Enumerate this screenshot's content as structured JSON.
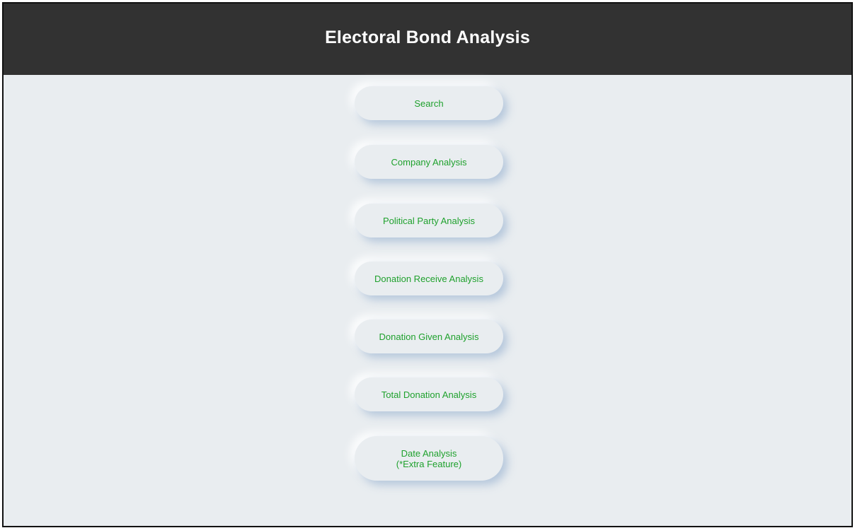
{
  "header": {
    "title": "Electoral Bond Analysis"
  },
  "menu": {
    "items": [
      {
        "label": "Search"
      },
      {
        "label": "Company Analysis"
      },
      {
        "label": "Political Party Analysis"
      },
      {
        "label": "Donation Receive Analysis"
      },
      {
        "label": "Donation Given Analysis"
      },
      {
        "label": "Total Donation Analysis"
      },
      {
        "label_line1": "Date Analysis",
        "label_line2": "(*Extra Feature)"
      }
    ]
  },
  "colors": {
    "header_background": "#323232",
    "header_text": "#ffffff",
    "page_background": "#e9edf0",
    "button_text": "#1fa12d"
  }
}
